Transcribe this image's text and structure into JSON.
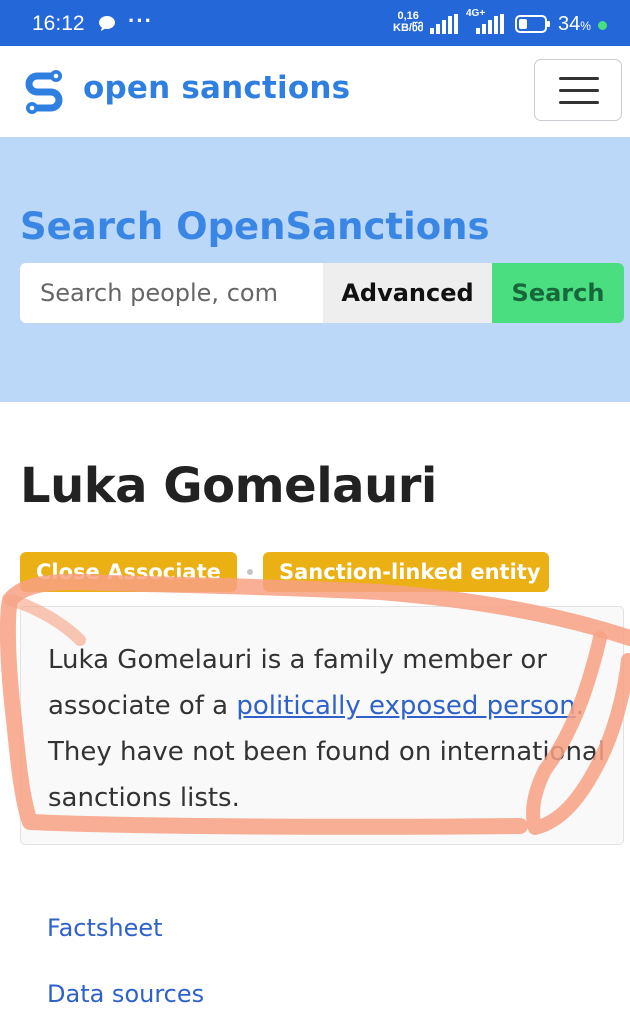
{
  "status_bar": {
    "time": "16:12",
    "dots": "···",
    "speed_value": "0,16",
    "speed_unit": "KB/წმ",
    "network": "4G+",
    "battery_level": 0.34,
    "battery_percent": "34",
    "percent_sign": "%",
    "icons": [
      "chat-icon",
      "signal-icon",
      "battery-icon"
    ]
  },
  "header": {
    "brand": "open sanctions",
    "menu_icon": "hamburger-menu-icon",
    "colors": {
      "brand": "#2f7fe0"
    }
  },
  "search": {
    "title": "Search OpenSanctions",
    "placeholder": "Search people, com",
    "advanced_label": "Advanced",
    "search_label": "Search",
    "colors": {
      "hero_bg": "#bcd8f9",
      "search_button": "#4ade80"
    }
  },
  "entity": {
    "name": "Luka Gomelauri",
    "badges": [
      "Close Associate",
      "Sanction-linked entity"
    ],
    "description": {
      "part1": "Luka Gomelauri is a family member or associate of a ",
      "link": "politically exposed person",
      "part2": ". They have not been found on international sanctions lists."
    },
    "colors": {
      "badge": "#ebb013",
      "annotation": "#f7a184"
    }
  },
  "links": {
    "factsheet": "Factsheet",
    "data_sources": "Data sources"
  }
}
